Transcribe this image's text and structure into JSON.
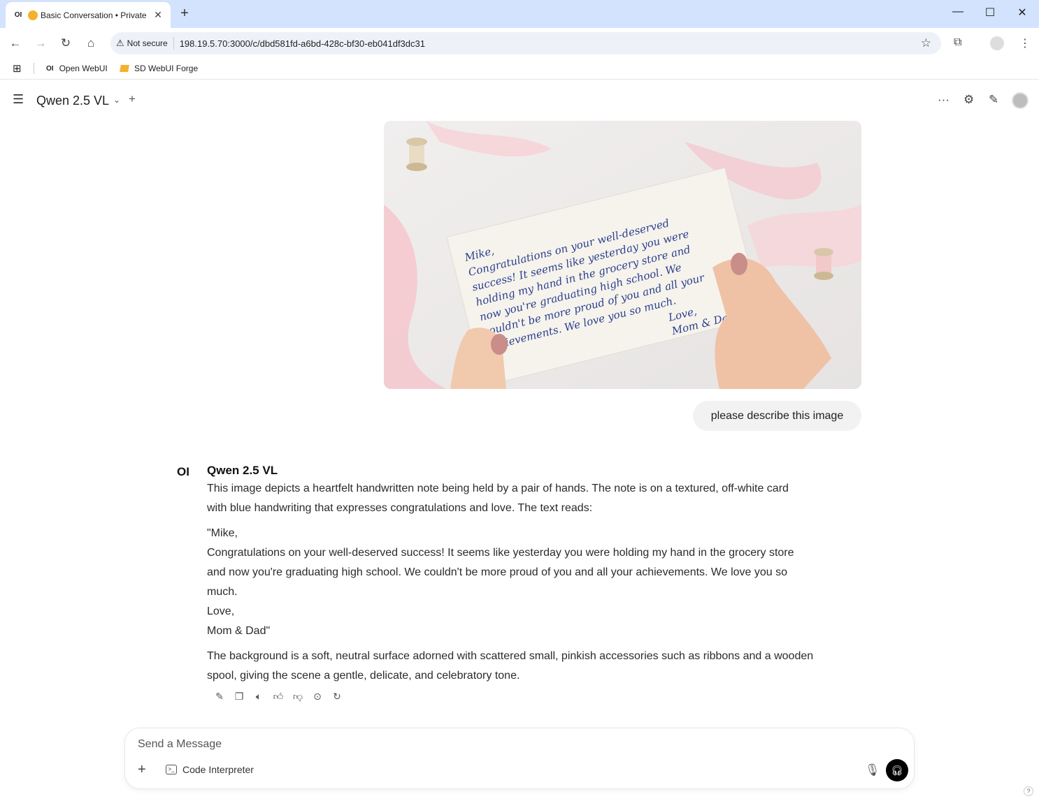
{
  "browser": {
    "tab_title": "Basic Conversation • Private",
    "tab_favicon_text": "OI",
    "not_secure_label": "Not secure",
    "url": "198.19.5.70:3000/c/dbd581fd-a6bd-428c-bf30-eb041df3dc31",
    "bookmarks": [
      {
        "label": "Open WebUI",
        "icon_text": "OI"
      },
      {
        "label": "SD WebUI Forge",
        "icon": "forge-icon"
      }
    ]
  },
  "header": {
    "model_name": "Qwen 2.5 VL"
  },
  "image": {
    "description_label": "handwritten note held by two hands",
    "note_lines": [
      "Mike,",
      "Congratulations on your well-deserved",
      "success! It seems like yesterday you were",
      "holding my hand in the grocery store and",
      "now you're graduating high school. We",
      "couldn't be more proud of you and all your",
      "achievements. We love you so much.",
      "Love,",
      "Mom & Dad"
    ]
  },
  "user_message": "please describe this image",
  "assistant": {
    "logo_text": "OI",
    "name": "Qwen 2.5 VL",
    "para1_line1": "This image depicts a heartfelt handwritten note being held by a pair of hands. The note is on a textured, off-white card",
    "para1_line2": "with blue handwriting that expresses congratulations and love. The text reads:",
    "quote_line1": "\"Mike,",
    "quote_line2": "Congratulations on your well-deserved success! It seems like yesterday you were holding my hand in the grocery store",
    "quote_line3": "and now you're graduating high school. We couldn't be more proud of you and all your achievements. We love you so",
    "quote_line4": "much.",
    "quote_line5": "Love,",
    "quote_line6": "Mom & Dad\"",
    "para3_line1": "The background is a soft, neutral surface adorned with scattered small, pinkish accessories such as ribbons and a wooden",
    "para3_line2": "spool, giving the scene a gentle, delicate, and celebratory tone."
  },
  "composer": {
    "placeholder": "Send a Message",
    "code_interpreter_label": "Code Interpreter"
  },
  "help_label": "?",
  "colors": {
    "titlebar": "#d3e3fd",
    "ink": "#2a3f8f",
    "card": "#f6f3ec",
    "ribbon": "#f4c9cf"
  }
}
